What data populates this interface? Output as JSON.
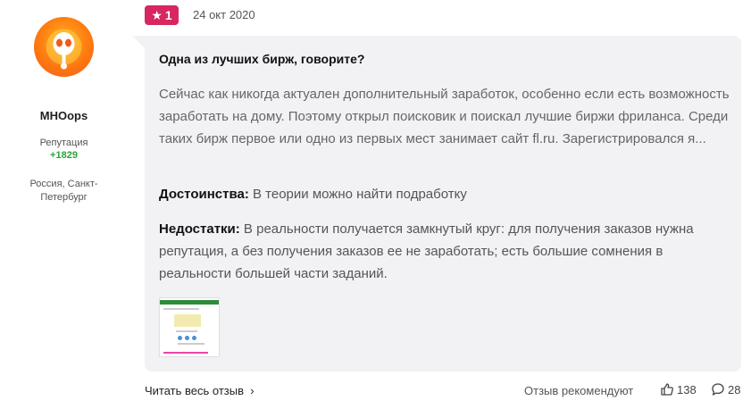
{
  "user": {
    "name": "MHOops",
    "reputation_label": "Репутация",
    "reputation_value": "+1829",
    "location": "Россия, Санкт-Петербург"
  },
  "review": {
    "rating": "1",
    "date": "24 окт 2020",
    "title": "Одна из лучших бирж, говорите?",
    "body": "Сейчас как никогда актуален дополнительный заработок, особенно если есть возможность заработать на дому. Поэтому открыл поисковик и поискал лучшие биржи фриланса. Среди таких бирж первое или одно из первых мест занимает сайт fl.ru. Зарегистрировался я...",
    "pros_label": "Достоинства:",
    "pros_text": " В теории можно найти подработку",
    "cons_label": "Недостатки:",
    "cons_text": " В реальности получается замкнутый круг: для получения заказов нужна репутация, а без получения заказов ее не заработать; есть большие сомнения в реальности большей части заданий."
  },
  "footer": {
    "read_more": "Читать весь отзыв",
    "recommends": "Отзыв рекомендуют",
    "likes": "138",
    "comments": "28"
  },
  "colors": {
    "rating_badge": "#d72660",
    "reputation": "#2aa53a",
    "card_bg": "#f2f2f4"
  },
  "icons": {
    "rating": "star-icon",
    "read_more": "chevron-right-icon",
    "likes": "thumbs-up-icon",
    "comments": "comment-icon"
  }
}
